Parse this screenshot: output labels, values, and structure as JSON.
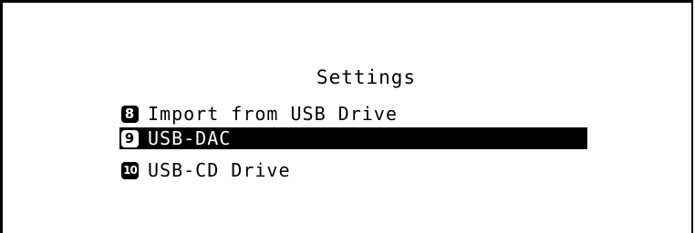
{
  "screen": {
    "title": "Settings"
  },
  "menu": {
    "items": [
      {
        "number": "8",
        "label": "Import from USB Drive",
        "selected": false
      },
      {
        "number": "9",
        "label": "USB-DAC",
        "selected": true
      },
      {
        "number": "10",
        "label": "USB-CD Drive",
        "selected": false
      }
    ]
  },
  "colors": {
    "background": "#ffffff",
    "text": "#000000",
    "highlight": "#000000",
    "highlight_text": "#ffffff"
  }
}
